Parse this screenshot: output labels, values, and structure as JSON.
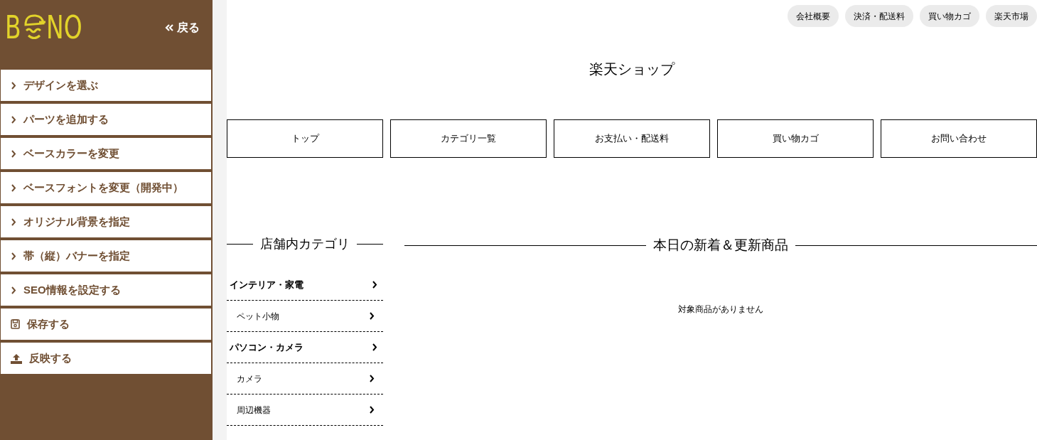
{
  "sidebar": {
    "logo": {
      "left": "B",
      "right": "NO"
    },
    "back": {
      "label": "戻る"
    },
    "items": [
      {
        "label": "デザインを選ぶ",
        "kind": "chevron"
      },
      {
        "label": "パーツを追加する",
        "kind": "chevron"
      },
      {
        "label": "ベースカラーを変更",
        "kind": "chevron"
      },
      {
        "label": "ベースフォントを変更（開発中）",
        "kind": "chevron"
      },
      {
        "label": "オリジナル背景を指定",
        "kind": "chevron"
      },
      {
        "label": "帯（縦）バナーを指定",
        "kind": "chevron"
      },
      {
        "label": "SEO情報を設定する",
        "kind": "chevron"
      },
      {
        "label": "保存する",
        "kind": "save"
      },
      {
        "label": "反映する",
        "kind": "upload"
      }
    ]
  },
  "header_links": [
    "会社概要",
    "決済・配送料",
    "買い物カゴ",
    "楽天市場"
  ],
  "shop_title": "楽天ショップ",
  "nav": [
    "トップ",
    "カテゴリ一覧",
    "お支払い・配送料",
    "買い物カゴ",
    "お問い合わせ"
  ],
  "categories": {
    "title": "店舗内カテゴリ",
    "items": [
      {
        "label": "インテリア・家電",
        "children": [
          {
            "label": "ペット小物"
          }
        ]
      },
      {
        "label": "パソコン・カメラ",
        "children": [
          {
            "label": "カメラ"
          },
          {
            "label": "周辺機器"
          }
        ]
      }
    ]
  },
  "new_items": {
    "title": "本日の新着＆更新商品",
    "empty_message": "対象商品がありません"
  }
}
